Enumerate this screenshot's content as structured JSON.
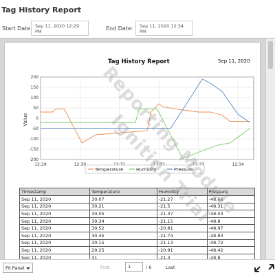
{
  "header": {
    "title": "Tag History Report"
  },
  "dates": {
    "start_label": "Start Date:",
    "start_value": "Sep 11, 2020 12:29 PM",
    "end_label": "End Date:",
    "end_value": "Sep 11, 2020 12:34 PM"
  },
  "report": {
    "title": "Tag History Report",
    "date": "Sep 11, 2020",
    "watermark_line1": "Reporting Module",
    "watermark_line2": "Ignition Trial"
  },
  "chart_data": {
    "type": "line",
    "ylabel": "Value",
    "xlabel": "",
    "ylim": [
      -200,
      200
    ],
    "yticks": [
      200,
      150,
      100,
      50,
      0,
      -50,
      -100,
      -150,
      -200
    ],
    "xticks": [
      "12:29",
      "12:30",
      "12:31",
      "12:32",
      "12:33",
      "12:34"
    ],
    "xlim_minutes": [
      0,
      5.4
    ],
    "legend_position": "bottom",
    "series": [
      {
        "name": "Temperature",
        "color": "#ee8a4a",
        "x": [
          0,
          0.3,
          0.38,
          0.6,
          1.05,
          1.4,
          2.7,
          2.8,
          3.0,
          3.1,
          3.6,
          4.0,
          4.3,
          4.6,
          4.8,
          5.3
        ],
        "y": [
          30,
          30,
          45,
          45,
          -120,
          -80,
          -60,
          30,
          70,
          55,
          40,
          30,
          30,
          15,
          -15,
          -15
        ]
      },
      {
        "name": "Humidity",
        "color": "#7cc96a",
        "x": [
          0,
          0.5,
          1.5,
          2.4,
          2.5,
          2.95,
          3.05,
          3.6,
          4.2,
          4.5,
          4.8,
          5.3
        ],
        "y": [
          -21,
          -21,
          -21,
          -21,
          45,
          45,
          10,
          -195,
          -150,
          -130,
          -120,
          -50
        ]
      },
      {
        "name": "Pressure",
        "color": "#5a86c6",
        "x": [
          0,
          1.0,
          2.0,
          3.0,
          3.3,
          4.1,
          4.3,
          4.6,
          5.0,
          5.3
        ],
        "y": [
          -48,
          -48,
          -48,
          -48,
          -48,
          190,
          170,
          130,
          20,
          -20
        ]
      }
    ]
  },
  "table": {
    "columns": [
      "Timestamp",
      "Temperature",
      "Humidity",
      "Pressure"
    ],
    "rows": [
      [
        "Sep 11, 2020",
        "30.07",
        "-21.27",
        "-48.66"
      ],
      [
        "Sep 11, 2020",
        "30.21",
        "-21.5",
        "-48.31"
      ],
      [
        "Sep 11, 2020",
        "30.05",
        "-21.37",
        "-48.03"
      ],
      [
        "Sep 11, 2020",
        "30.34",
        "-21.15",
        "-48.8"
      ],
      [
        "Sep 11, 2020",
        "30.52",
        "-20.81",
        "-48.97"
      ],
      [
        "Sep 11, 2020",
        "30.45",
        "-21.74",
        "-48.83"
      ],
      [
        "Sep 11, 2020",
        "30.15",
        "-21.13",
        "-48.72"
      ],
      [
        "Sep 11, 2020",
        "29.25",
        "-20.91",
        "-48.42"
      ],
      [
        "Sep 11, 2020",
        "31",
        "-21.3",
        "-48.8"
      ]
    ]
  },
  "footer": {
    "fit_label": "Fit Panel",
    "first_label": "First",
    "page_value": "1",
    "page_total": "/ 6",
    "last_label": "Last"
  }
}
